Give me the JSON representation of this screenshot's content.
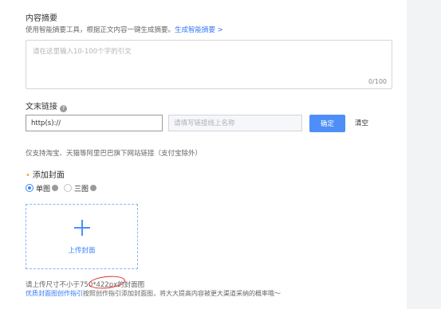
{
  "summary": {
    "title": "内容摘要",
    "description": "使用智能摘要工具，根据正文内容一键生成摘要。",
    "generate_link": "生成智能摘要 >",
    "placeholder": "请在这里输入10-100个字的引文",
    "counter": "0/100"
  },
  "link_section": {
    "title": "文末链接",
    "url_value": "http(s)://",
    "name_placeholder": "请填写链接线上名称",
    "confirm_label": "确定",
    "clear_label": "清空",
    "note": "仅支持淘宝、天猫等阿里巴巴旗下网站链接（支付宝除外）"
  },
  "cover": {
    "title": "添加封面",
    "options": [
      {
        "label": "单图",
        "checked": true
      },
      {
        "label": "三图",
        "checked": false
      }
    ],
    "upload_label": "上传封面",
    "size_hint_prefix": "请上传尺寸不小于",
    "size_hint_size": "750*422px",
    "size_hint_suffix": "的封面图",
    "guide_link": "优质封面图创作指引",
    "guide_text": "按照创作指引添加封面图，将大大提高内容被更大渠道采纳的概率哦～"
  },
  "colors": {
    "accent": "#4d8ef8",
    "link": "#3478f6",
    "annotation": "#e02a2a",
    "required": "#f5a623"
  }
}
